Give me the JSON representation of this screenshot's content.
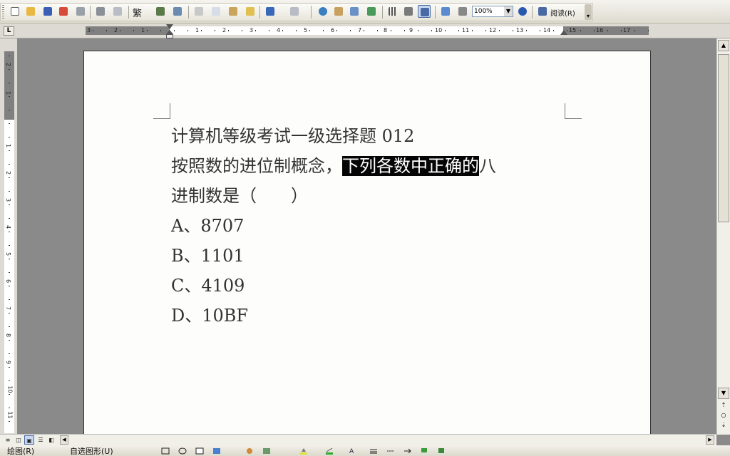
{
  "toolbar": {
    "fan_label": "繁",
    "zoom": "100%",
    "read_label": "阅读",
    "read_hotkey": "(R)"
  },
  "ruler": {
    "corner": "L",
    "left_numbers": [
      "3",
      "2",
      "1"
    ],
    "right_numbers": [
      "2",
      "4",
      "6",
      "8",
      "10",
      "12",
      "14",
      "16"
    ],
    "odd_numbers": [
      "1",
      "3",
      "5",
      "7",
      "9",
      "11",
      "13",
      "15",
      "17"
    ],
    "vertical_numbers": [
      "2",
      "1",
      "1",
      "2",
      "3",
      "4",
      "5",
      "6",
      "7",
      "8",
      "9",
      "10",
      "11"
    ]
  },
  "document": {
    "title": "计算机等级考试一级选择题 012",
    "question_before": "按照数的进位制概念，",
    "question_highlight": "下列各数中正确的",
    "question_after": "八",
    "question_line2": "进制数是（　　）",
    "option_a": "A、8707",
    "option_b": "B、1101",
    "option_c": "C、4109",
    "option_d": "D、10BF"
  },
  "drawbar": {
    "draw_label": "绘图(R)",
    "autoshape_label": "自选图形(U)"
  }
}
